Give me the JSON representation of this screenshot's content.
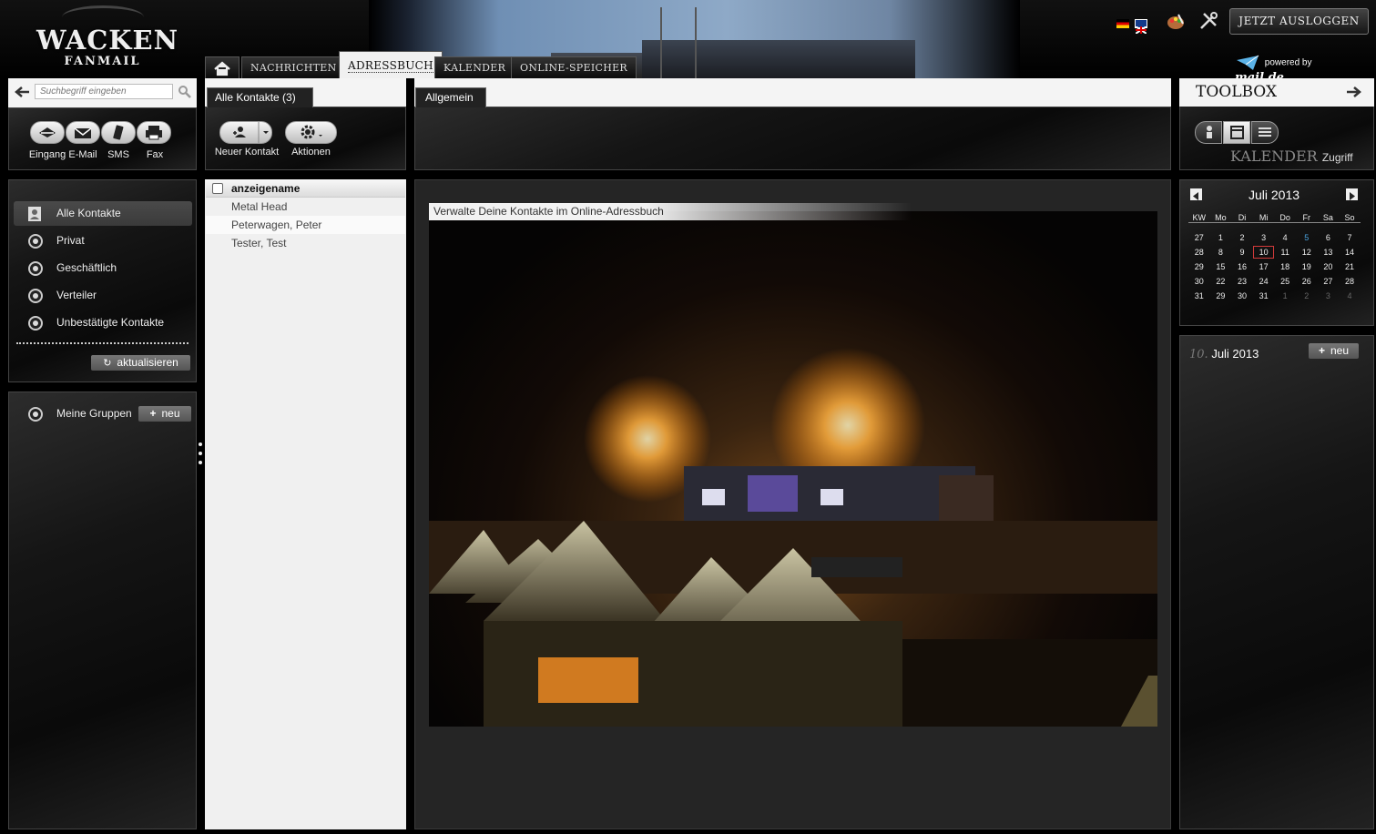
{
  "brand": {
    "logo_line1": "WACKEN",
    "logo_line2": "FANMAIL"
  },
  "tabs": [
    {
      "label": "NACHRICHTEN"
    },
    {
      "label": "ADRESSBUCH"
    },
    {
      "label": "KALENDER"
    },
    {
      "label": "ONLINE-SPEICHER"
    }
  ],
  "header": {
    "logout_label": "JETZT AUSLOGGEN",
    "powered_by": "powered by",
    "powered_brand": "mail.de"
  },
  "search": {
    "placeholder": "Suchbegriff eingeben"
  },
  "quick": [
    {
      "label": "Eingang"
    },
    {
      "label": "E-Mail"
    },
    {
      "label": "SMS"
    },
    {
      "label": "Fax"
    }
  ],
  "nav": {
    "items": [
      {
        "label": "Alle Kontakte"
      },
      {
        "label": "Privat"
      },
      {
        "label": "Geschäftlich"
      },
      {
        "label": "Verteiler"
      },
      {
        "label": "Unbestätigte Kontakte"
      }
    ],
    "refresh_label": "aktualisieren"
  },
  "groups": {
    "label": "Meine Gruppen",
    "new_label": "neu"
  },
  "contacts": {
    "tab_label": "Alle Kontakte (3)",
    "new_contact_label": "Neuer Kontakt",
    "actions_label": "Aktionen",
    "column_header": "anzeigename",
    "rows": [
      "Metal Head",
      "Peterwagen, Peter",
      "Tester, Test"
    ]
  },
  "detail": {
    "tab_label": "Allgemein",
    "caption": "Verwalte Deine Kontakte im Online-Adressbuch"
  },
  "toolbox": {
    "title": "TOOLBOX",
    "mode_label": "KALENDER",
    "mode_suffix": "Zugriff"
  },
  "calendar": {
    "month_label": "Juli 2013",
    "headers": [
      "KW",
      "Mo",
      "Di",
      "Mi",
      "Do",
      "Fr",
      "Sa",
      "So"
    ],
    "weeks": [
      [
        "27",
        "1",
        "2",
        "3",
        "4",
        "5",
        "6",
        "7"
      ],
      [
        "28",
        "8",
        "9",
        "10",
        "11",
        "12",
        "13",
        "14"
      ],
      [
        "29",
        "15",
        "16",
        "17",
        "18",
        "19",
        "20",
        "21"
      ],
      [
        "30",
        "22",
        "23",
        "24",
        "25",
        "26",
        "27",
        "28"
      ],
      [
        "31",
        "29",
        "30",
        "31",
        "1",
        "2",
        "3",
        "4"
      ]
    ],
    "today": "10",
    "highlight": "5"
  },
  "events": {
    "day": "10.",
    "date_label": "Juli 2013",
    "new_label": "neu"
  },
  "colors": {
    "accent": "#4aa3df",
    "today_border": "#d23a3a"
  }
}
